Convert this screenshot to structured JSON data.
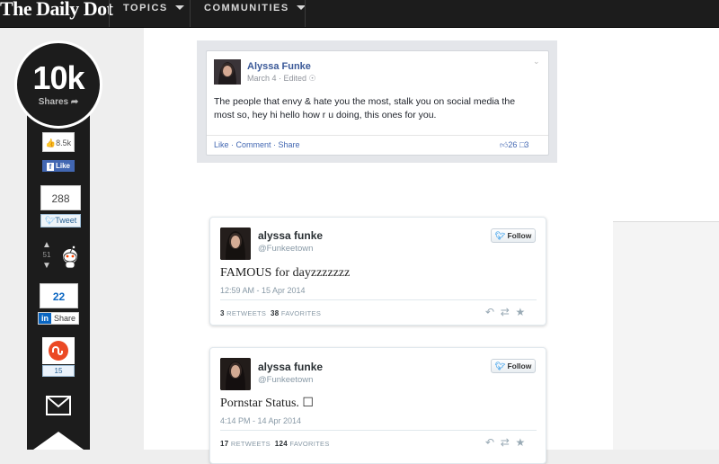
{
  "header": {
    "logo": "The Daily Dot",
    "nav": [
      {
        "label": "TOPICS"
      },
      {
        "label": "COMMUNITIES"
      }
    ]
  },
  "share": {
    "total": "10k",
    "total_label": "Shares",
    "facebook": {
      "count": "8.5k",
      "button": "Like"
    },
    "twitter": {
      "count": "288",
      "button": "Tweet"
    },
    "reddit": {
      "score": "51"
    },
    "linkedin": {
      "count": "22",
      "button": "Share"
    },
    "stumbleupon": {
      "count": "15"
    }
  },
  "facebook_post": {
    "author": "Alyssa Funke",
    "meta": "March 4 · Edited",
    "text": "The people that envy & hate you the most, stalk you on social media the most so, hey hi hello how r u doing, this ones for you.",
    "actions": "Like · Comment · Share",
    "likes": "26",
    "comments": "3"
  },
  "tweets": [
    {
      "name": "alyssa funke",
      "handle": "@Funkeetown",
      "follow": "Follow",
      "text": "FAMOUS for dayzzzzzzz",
      "time": "12:59 AM - 15 Apr 2014",
      "retweets": "3",
      "retweets_label": "RETWEETS",
      "favorites": "38",
      "favorites_label": "FAVORITES"
    },
    {
      "name": "alyssa funke",
      "handle": "@Funkeetown",
      "follow": "Follow",
      "text": "Pornstar Status. ☐",
      "time": "4:14 PM - 14 Apr 2014",
      "retweets": "17",
      "retweets_label": "RETWEETS",
      "favorites": "124",
      "favorites_label": "FAVORITES"
    }
  ],
  "colors": {
    "topbar": "#1c1c1c",
    "facebook": "#4267b2",
    "twitter": "#55acee",
    "linkedin": "#0a66c2",
    "stumbleupon": "#eb4924"
  }
}
